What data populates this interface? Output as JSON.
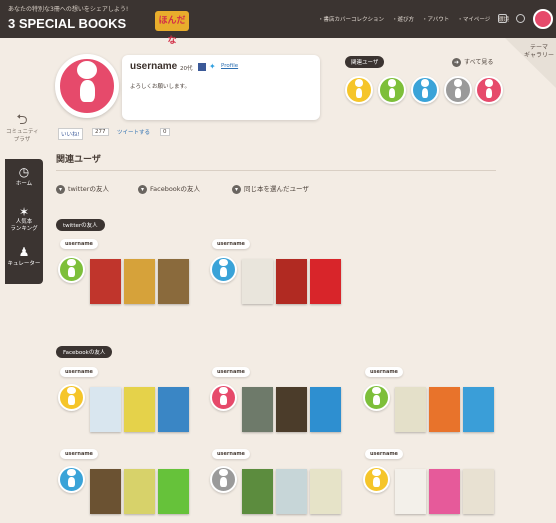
{
  "header": {
    "tagline": "あなたの特別な3冊への想いをシェアしよう!",
    "logo": "3 SPECIAL BOOKS",
    "badge": "ほんだな",
    "nav": [
      "・書店カバーコレクション",
      "・遊び方",
      "・アバウト",
      "・マイページ"
    ],
    "settings": "環境"
  },
  "theme_gallery": "テーマ\nギャラリー",
  "sidebar": {
    "community": "コミュニティ\nプラザ",
    "items": [
      {
        "label": "ホーム",
        "icon": "clock-icon"
      },
      {
        "label": "人気本\nランキング",
        "icon": "sparkle-icon"
      },
      {
        "label": "キュレーター",
        "icon": "curator-icon"
      }
    ]
  },
  "profile": {
    "username": "username",
    "age": "20代",
    "profile_link": "Profile",
    "greeting": "よろしくお願いします。",
    "like_label": "いいね!",
    "like_count": "277",
    "tweet_label": "ツイートする",
    "tweet_count": "0",
    "avatar_color": "#e64a6b"
  },
  "related": {
    "badge": "関連ユーザ",
    "see_all": "すべて見る",
    "avatars": [
      "#f5c52a",
      "#7dbf3a",
      "#3aa3d8",
      "#9a9a9a",
      "#e64a6b"
    ]
  },
  "section": {
    "title": "関連ユーザ",
    "filters": [
      "twitterの友人",
      "Facebookの友人",
      "同じ本を選んだユーザ"
    ]
  },
  "twitter": {
    "badge": "twitterの友人",
    "friends": [
      {
        "name": "username",
        "avatar": "#7dbf3a",
        "books": [
          "#c0352c",
          "#d6a23a",
          "#8a6a3c"
        ]
      },
      {
        "name": "username",
        "avatar": "#3aa3d8",
        "books": [
          "#e9e5dc",
          "#b12a22",
          "#d8252a"
        ]
      }
    ]
  },
  "facebook": {
    "badge": "Facebookの友人",
    "friends": [
      {
        "name": "username",
        "avatar": "#f5c52a",
        "books": [
          "#d9e6ef",
          "#e5d24a",
          "#3a86c5"
        ]
      },
      {
        "name": "username",
        "avatar": "#e64a6b",
        "books": [
          "#6e7a6a",
          "#4b3c2a",
          "#2e8fd0"
        ]
      },
      {
        "name": "username",
        "avatar": "#7dbf3a",
        "books": [
          "#e4e0c9",
          "#e8732b",
          "#3a9ed8"
        ]
      },
      {
        "name": "username",
        "avatar": "#3aa3d8",
        "books": [
          "#6b5232",
          "#d7d26a",
          "#66c23a"
        ]
      },
      {
        "name": "username",
        "avatar": "#9a9a9a",
        "books": [
          "#5c8c3e",
          "#c7d6d8",
          "#e6e3c8"
        ]
      },
      {
        "name": "username",
        "avatar": "#f5c52a",
        "books": [
          "#f3f0ea",
          "#e65a9a",
          "#e8e1d2"
        ]
      }
    ]
  }
}
